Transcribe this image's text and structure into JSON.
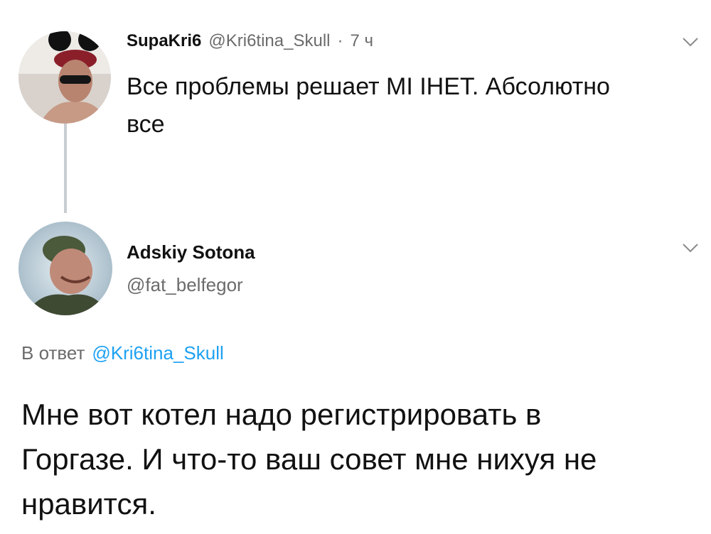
{
  "colors": {
    "background": "#ffffff",
    "text": "#111111",
    "secondary": "#6b6b6b",
    "link": "#1da1f2",
    "thread_line": "#c9cdd1"
  },
  "tweet": {
    "display_name": "SupaKri6",
    "handle": "@Kri6tina_Skull",
    "separator": "·",
    "time": "7 ч",
    "text_line1": "Все проблемы решает МІ ІНЕТ. Абсолютно",
    "text_line2": "все",
    "menu_icon": "chevron-down-icon",
    "avatar_icon": "avatar-icon"
  },
  "reply": {
    "display_name": "Adskiy Sotona",
    "handle": "@fat_belfegor",
    "menu_icon": "chevron-down-icon",
    "avatar_icon": "avatar-icon",
    "in_reply_prefix": "В ответ",
    "in_reply_handle": "@Kri6tina_Skull",
    "body_line1": "Мне вот котел надо регистрировать в",
    "body_line2": "Горгазе. И что-то ваш совет мне нихуя не",
    "body_line3": "нравится."
  }
}
